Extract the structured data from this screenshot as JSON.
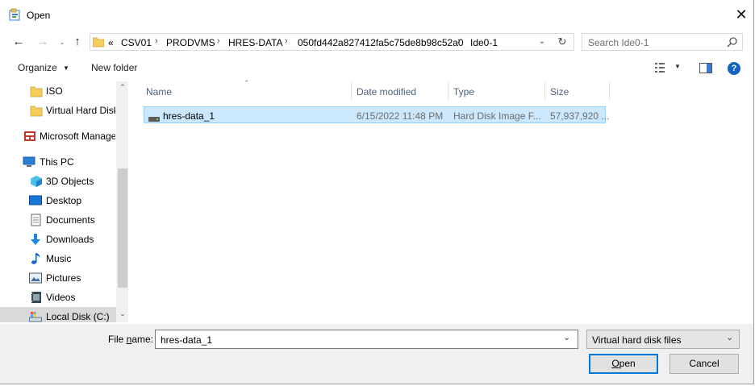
{
  "window": {
    "title": "Open"
  },
  "address": {
    "overflow": "«",
    "crumbs": [
      "CSV01",
      "PRODVMS",
      "HRES-DATA",
      "050fd442a827412fa5c75de8b98c52a0",
      "Ide0-1"
    ]
  },
  "search": {
    "placeholder": "Search Ide0-1"
  },
  "toolbar": {
    "organize": "Organize",
    "new_folder": "New folder"
  },
  "nav_tree": {
    "items": [
      {
        "label": "ISO",
        "icon": "folder-icon"
      },
      {
        "label": "Virtual Hard Disk",
        "icon": "folder-icon"
      },
      {
        "label": "Microsoft Manage",
        "icon": "management-console-icon"
      },
      {
        "label": "This PC",
        "icon": "computer-icon"
      },
      {
        "label": "3D Objects",
        "icon": "3d-objects-icon"
      },
      {
        "label": "Desktop",
        "icon": "desktop-icon"
      },
      {
        "label": "Documents",
        "icon": "documents-icon"
      },
      {
        "label": "Downloads",
        "icon": "downloads-icon"
      },
      {
        "label": "Music",
        "icon": "music-icon"
      },
      {
        "label": "Pictures",
        "icon": "pictures-icon"
      },
      {
        "label": "Videos",
        "icon": "videos-icon"
      },
      {
        "label": "Local Disk (C:)",
        "icon": "local-disk-icon"
      }
    ]
  },
  "file_list": {
    "columns": [
      "Name",
      "Date modified",
      "Type",
      "Size"
    ],
    "rows": [
      {
        "name": "hres-data_1",
        "date_modified": "6/15/2022 11:48 PM",
        "type": "Hard Disk Image F...",
        "size": "57,937,920 ..."
      }
    ]
  },
  "footer": {
    "file_name_label_pre": "File ",
    "file_name_label_ul": "n",
    "file_name_label_post": "ame:",
    "file_name_value": "hres-data_1",
    "file_type": "Virtual hard disk files",
    "open_ul": "O",
    "open_rest": "pen",
    "cancel": "Cancel"
  },
  "colors": {
    "selection": "#cce8ff",
    "accent": "#0078d7",
    "folder": "#e8c05a"
  }
}
